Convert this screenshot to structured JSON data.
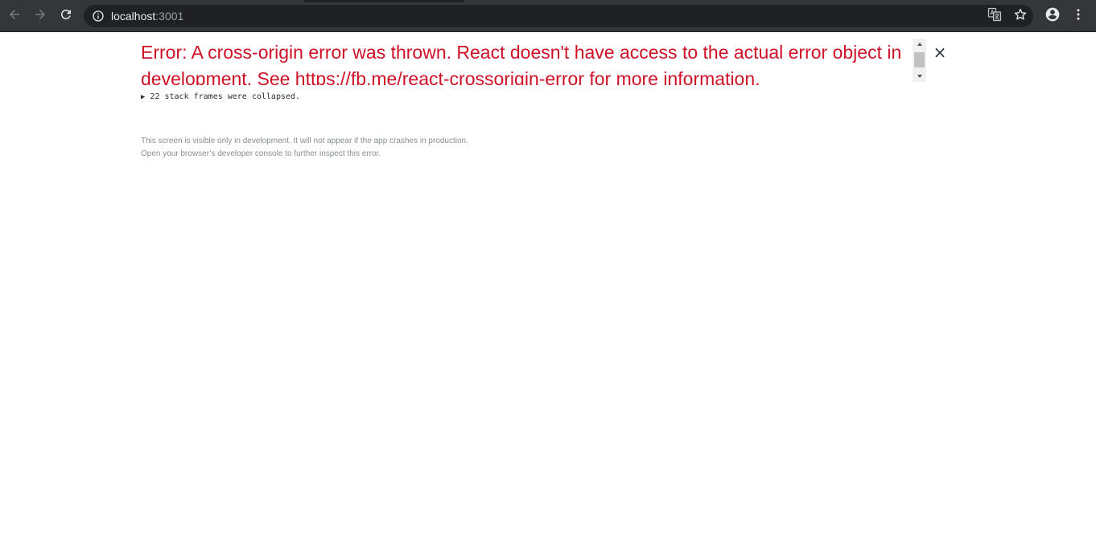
{
  "browser": {
    "address": {
      "host": "localhost",
      "port": ":3001"
    },
    "icons": {
      "back": "arrow-back-icon",
      "forward": "arrow-forward-icon",
      "reload": "reload-icon",
      "site_info": "info-icon",
      "translate": "translate-icon",
      "bookmark": "star-icon",
      "profile": "account-circle-icon",
      "menu": "kebab-menu-icon"
    }
  },
  "error_overlay": {
    "title": "Error: A cross-origin error was thrown. React doesn't have access to the actual error object in development. See https://fb.me/react-crossorigin-error for more information.",
    "close_label": "×",
    "stack_toggle": "22 stack frames were collapsed.",
    "footer_line1": "This screen is visible only in development. It will not appear if the app crashes in production.",
    "footer_line2": "Open your browser’s developer console to further inspect this error.",
    "colors": {
      "title": "#ce1126",
      "footer": "#878e91"
    }
  }
}
